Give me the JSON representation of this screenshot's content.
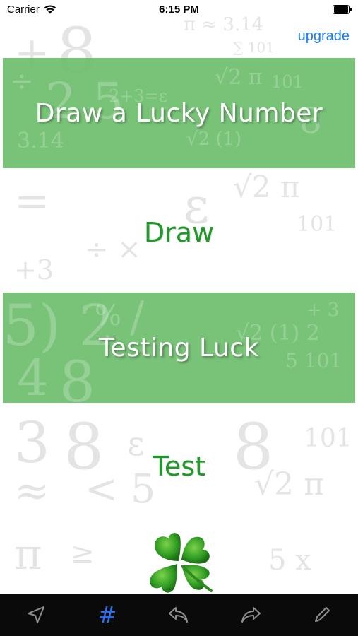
{
  "status_bar": {
    "carrier": "Carrier",
    "time": "6:15 PM"
  },
  "header": {
    "upgrade_label": "upgrade"
  },
  "sections": {
    "draw_title": "Draw a Lucky Number",
    "draw_button": "Draw",
    "test_title": "Testing Luck",
    "test_button": "Test"
  },
  "tab_bar": {
    "items": [
      {
        "icon": "send-icon"
      },
      {
        "icon": "hash-icon",
        "label": "#",
        "active": true
      },
      {
        "icon": "undo-icon"
      },
      {
        "icon": "redo-icon"
      },
      {
        "icon": "pencil-icon"
      }
    ]
  },
  "colors": {
    "banner_green": "#6ebe6e",
    "button_text_green": "#1f9a2a",
    "link_blue": "#1c7ef0",
    "tab_active": "#2a6ff0",
    "tab_inactive": "#8e8e8e",
    "tab_bg": "#0a0a0a"
  },
  "decoration": {
    "background_glyphs": [
      "∞",
      "π ≈ 3.14",
      "√2",
      "∑",
      "101",
      "8",
      "3",
      "≈",
      "÷",
      "+",
      "×",
      "≥",
      "ε"
    ],
    "clover": "four-leaf-clover-icon"
  }
}
